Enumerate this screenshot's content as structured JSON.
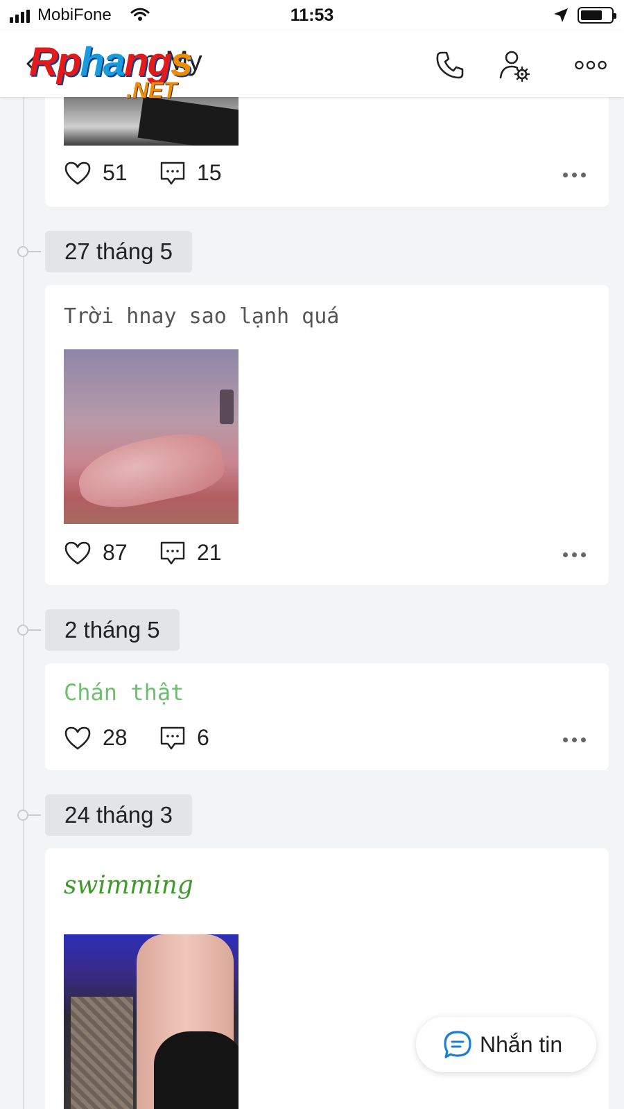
{
  "status_bar": {
    "carrier": "MobiFone",
    "time": "11:53"
  },
  "header": {
    "title": "n My",
    "watermark": "Rphangs.NET",
    "icons": [
      "back-icon",
      "phone-icon",
      "user-settings-icon",
      "more-icon"
    ]
  },
  "posts": [
    {
      "date": "",
      "text": "",
      "has_photo": true,
      "likes": "51",
      "comments": "15"
    },
    {
      "date": "27 tháng 5",
      "text": "Trời hnay sao lạnh quá",
      "text_color": "#555555",
      "has_photo": true,
      "likes": "87",
      "comments": "21"
    },
    {
      "date": "2 tháng 5",
      "text": "Chán thật",
      "text_color": "#6cbf6c",
      "has_photo": false,
      "likes": "28",
      "comments": "6"
    },
    {
      "date": "24 tháng 3",
      "text": "swimming",
      "text_color": "#3f9a2c",
      "has_photo": true
    }
  ],
  "message_button": {
    "label": "Nhắn tin"
  },
  "colors": {
    "background": "#f3f4f6",
    "card": "#ffffff",
    "date_chip": "#e3e4e6",
    "accent_blue": "#1a7fd6"
  }
}
